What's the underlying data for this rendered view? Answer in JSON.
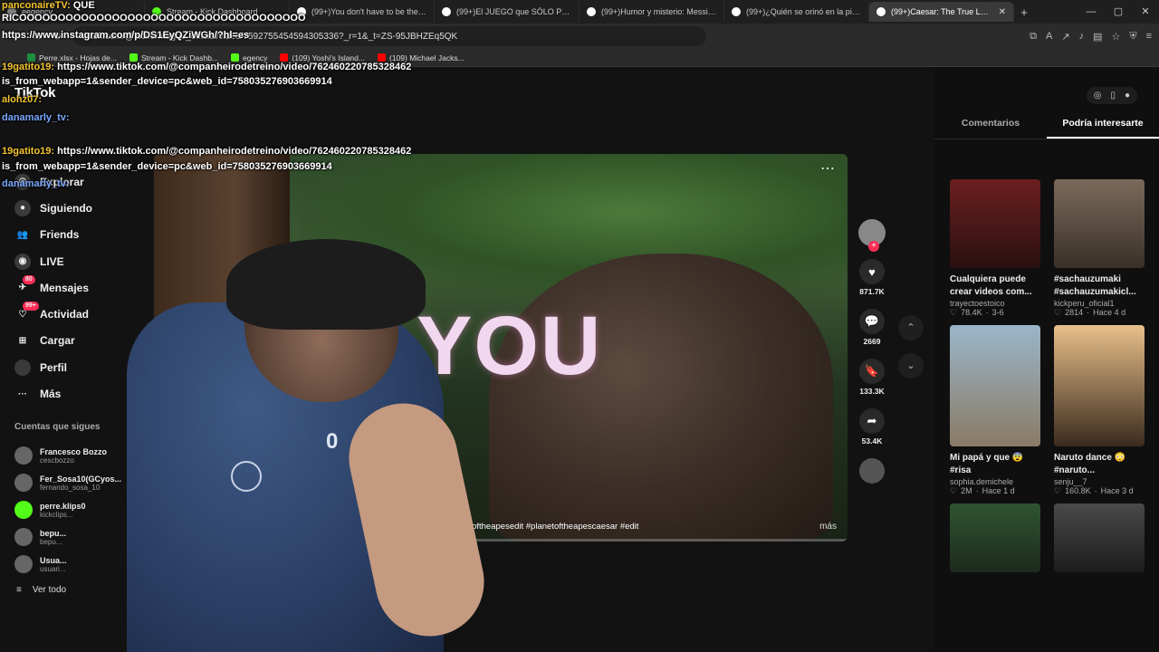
{
  "browser": {
    "tabs": [
      {
        "title": "eegency",
        "active": false
      },
      {
        "title": "Stream - Kick Dashboard",
        "active": false
      },
      {
        "title": "(99+)You don't have to be the bad guy",
        "active": false
      },
      {
        "title": "(99+)El JUEGO que SÓLO PODES JUGAR",
        "active": false
      },
      {
        "title": "(99+)Humor y misterio: Messi y Cristiano",
        "active": false
      },
      {
        "title": "(99+)¿Quién se orinó en la piscina?",
        "active": false
      },
      {
        "title": "(99+)Caesar: The True Leader",
        "active": true
      }
    ],
    "url": "tiktok.com/@lucifermagne_official/video/7592755454594305336?_r=1&_t=ZS-95JBHZEq5QK",
    "bookmarks": [
      "Perre.xlsx - Hojas de...",
      "Stream - Kick Dashb...",
      "egency",
      "(109) Yoshi's Island...",
      "(109) Michael Jacks..."
    ]
  },
  "tiktok": {
    "logo": "TikTok",
    "nav": [
      {
        "label": "Explorar",
        "icon": "compass-icon",
        "badge": ""
      },
      {
        "label": "Siguiendo",
        "icon": "following-icon",
        "badge": ""
      },
      {
        "label": "Friends",
        "icon": "friends-icon",
        "badge": ""
      },
      {
        "label": "LIVE",
        "icon": "live-icon",
        "badge": ""
      },
      {
        "label": "Mensajes",
        "icon": "messages-icon",
        "badge": "80"
      },
      {
        "label": "Actividad",
        "icon": "activity-icon",
        "badge": "99+"
      },
      {
        "label": "Cargar",
        "icon": "upload-icon",
        "badge": ""
      },
      {
        "label": "Perfil",
        "icon": "profile-icon",
        "badge": ""
      },
      {
        "label": "Más",
        "icon": "more-icon",
        "badge": ""
      }
    ],
    "following_title": "Cuentas que sigues",
    "following": [
      {
        "name": "Francesco Bozzo",
        "handle": "cescbozzo"
      },
      {
        "name": "Fer_Sosa10(GCyos...",
        "handle": "fernando_sosa_10"
      },
      {
        "name": "perre.klips0",
        "handle": "kickclips..."
      },
      {
        "name": "bepu...",
        "handle": "bepu..."
      },
      {
        "name": "Usua...",
        "handle": "usuari..."
      }
    ],
    "see_more": "Ver todo",
    "video": {
      "overlay_text": "YOU",
      "caption": "gain #caesar #c... etoftheapes #planetoftheapesedit #planetoftheapescaesar #edit",
      "more": "más",
      "progress": 0.38
    },
    "actions": {
      "likes": "871.7K",
      "comments": "2669",
      "saves": "133.3K",
      "shares": "53.4K"
    },
    "right_panel": {
      "tabs": [
        "Comentarios",
        "Podría interesarte"
      ],
      "active_tab": "Podría interesarte",
      "cards": [
        {
          "title": "Cualquiera puede crear videos com...",
          "author": "trayectoestoico",
          "likes": "78.4K",
          "age": "3-6"
        },
        {
          "title": "#sachauzumaki #sachauzumakicl...",
          "author": "kickperu_oficial1",
          "likes": "2814",
          "age": "Hace 4 d"
        },
        {
          "title": "Mi papá y que 😨 #risa",
          "author": "sophia.demichele",
          "likes": "2M",
          "age": "Hace 1 d"
        },
        {
          "title": "Naruto dance 😳 #naruto...",
          "author": "senju__7",
          "likes": "160.8K",
          "age": "Hace 3 d"
        },
        {
          "title": "",
          "author": "",
          "likes": "",
          "age": ""
        },
        {
          "title": "",
          "author": "",
          "likes": "",
          "age": ""
        }
      ]
    }
  },
  "chat": [
    {
      "user": "panconaireTV:",
      "text": "QUE"
    },
    {
      "user": "",
      "text": "RICOOOOOOOOOOOOOOOOOOOOOOOOOOOOOOOOOOOOO"
    },
    {
      "user": "",
      "text": "https://www.instagram.com/p/DS1EyQZiWGh/?hl=es"
    },
    {
      "user": "19gatito19:",
      "text": "https://www.tiktok.com/@companheirodetreino/video/762460220785328462"
    },
    {
      "user": "",
      "text": "is_from_webapp=1&sender_device=pc&web_id=758035276903669914"
    },
    {
      "user": "alohz07:",
      "text": ""
    },
    {
      "user": "danamarly_tv:",
      "text": ""
    },
    {
      "user": "19gatito19:",
      "text": "https://www.tiktok.com/@companheirodetreino/video/762460220785328462"
    },
    {
      "user": "",
      "text": "is_from_webapp=1&sender_device=pc&web_id=758035276903669914"
    },
    {
      "user": "danamarly_tv:",
      "text": ""
    }
  ]
}
